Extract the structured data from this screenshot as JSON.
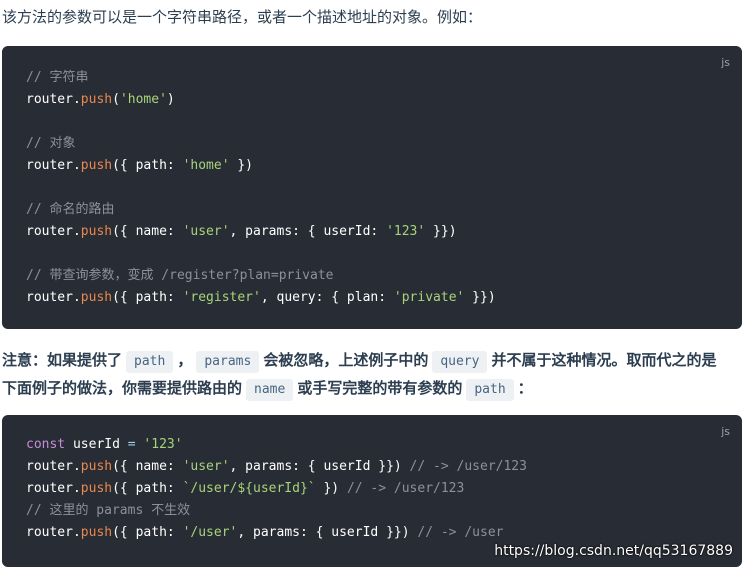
{
  "intro": "该方法的参数可以是一个字符串路径，或者一个描述地址的对象。例如：",
  "block1": {
    "lang": "js",
    "comment1": "// 字符串",
    "comment2": "// 对象",
    "comment3": "// 命名的路由",
    "comment4": "// 带查询参数，变成 /register?plan=private",
    "str_home": "'home'",
    "str_user": "'user'",
    "str_123": "'123'",
    "str_register": "'register'",
    "str_private": "'private'"
  },
  "note": {
    "p1": "注意：如果提供了",
    "c_path": "path",
    "sep": "，",
    "c_params": "params",
    "p2": "会被忽略，上述例子中的",
    "c_query": "query",
    "p3": "并不属于这种情况。取而代之的是",
    "p4": "下面例子的做法，你需要提供路由的",
    "c_name": "name",
    "p5": "或手写完整的带有参数的",
    "c_path2": "path",
    "p6": "："
  },
  "block2": {
    "lang": "js",
    "str_123": "'123'",
    "str_user": "'user'",
    "comment_a": "// -> /user/123",
    "tpl": "`/user/${userId}`",
    "comment_b": "// -> /user/123",
    "comment_c": "// 这里的 params 不生效",
    "str_path_user": "'/user'",
    "comment_d": "// -> /user"
  },
  "watermark": "https://blog.csdn.net/qq53167889"
}
